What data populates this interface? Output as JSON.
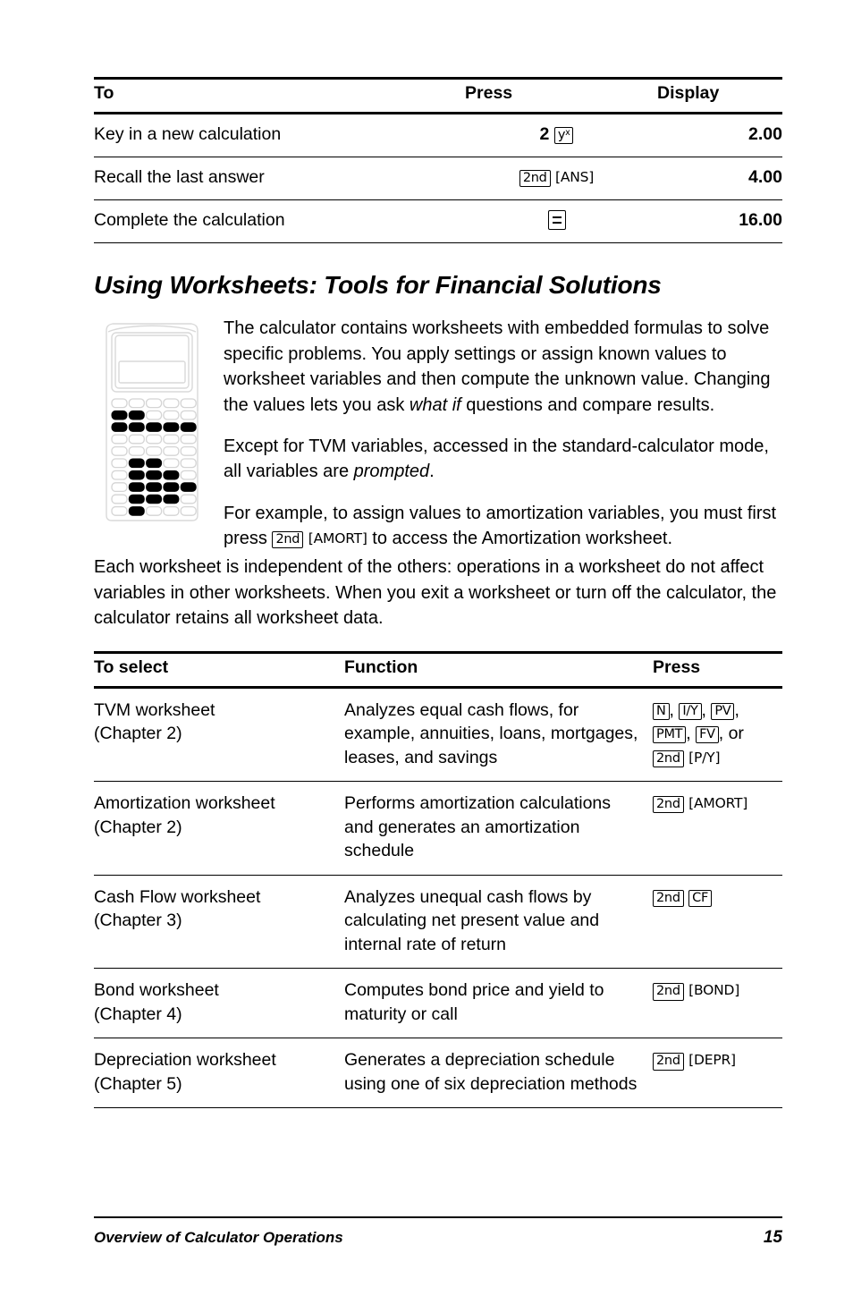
{
  "table_one": {
    "headers": [
      "To",
      "Press",
      "Display"
    ],
    "rows": [
      {
        "to": "Key in a new calculation",
        "press_prefix": "2",
        "press_key": "y",
        "press_sup": "x",
        "display": "2.00"
      },
      {
        "to": "Recall the last answer",
        "press_key": "2nd",
        "press_bracket": "[ANS]",
        "display": "4.00"
      },
      {
        "to": "Complete the calculation",
        "press_key": "=",
        "display": "16.00"
      }
    ]
  },
  "section": {
    "title": "Using Worksheets: Tools for Financial Solutions"
  },
  "intro": {
    "para1_a": "The calculator contains worksheets with embedded formulas to solve specific problems. You apply settings or assign known values to worksheet variables and then compute the unknown value. Changing the values lets you ask ",
    "para1_em": "what if",
    "para1_b": " questions and compare results.",
    "para2_a": "Except for TVM variables, accessed in the standard-calculator mode, all variables are ",
    "para2_em": "prompted",
    "para2_b": ".",
    "para3_a": "For example, to assign values to amortization variables, you must first press ",
    "para3_key": "2nd",
    "para3_bracket": "[AMORT]",
    "para3_b": " to access the Amortization worksheet."
  },
  "wide_paragraph": "Each worksheet is independent of the others: operations in a worksheet do not affect variables in other worksheets. When you exit a worksheet or turn off the calculator, the calculator retains all worksheet data.",
  "table_two": {
    "headers": [
      "To select",
      "Function",
      "Press"
    ],
    "rows": [
      {
        "select_line1": "TVM worksheet",
        "select_line2": "(Chapter 2)",
        "function": "Analyzes equal cash flows, for example, annuities, loans, mortgages, leases, and savings",
        "press_keys": [
          "N",
          "I/Y",
          "PV",
          "PMT",
          "FV"
        ],
        "press_or": "or",
        "press_second": "2nd",
        "press_bracket": "[P/Y]"
      },
      {
        "select_line1": "Amortization worksheet",
        "select_line2": "(Chapter 2)",
        "function": "Performs amortization calculations and generates an amortization schedule",
        "press_second": "2nd",
        "press_bracket": "[AMORT]"
      },
      {
        "select_line1": "Cash Flow worksheet",
        "select_line2": "(Chapter 3)",
        "function": "Analyzes unequal cash flows by calculating net present value and internal rate of return",
        "press_second": "2nd",
        "press_boxed": "CF"
      },
      {
        "select_line1": "Bond worksheet",
        "select_line2": "(Chapter 4)",
        "function": "Computes bond price and yield to maturity or call",
        "press_second": "2nd",
        "press_bracket": "[BOND]"
      },
      {
        "select_line1": "Depreciation worksheet",
        "select_line2": "(Chapter 5)",
        "function": "Generates a depreciation schedule using one of six depreciation methods",
        "press_second": "2nd",
        "press_bracket": "[DEPR]"
      }
    ]
  },
  "footer": {
    "chapter": "Overview of Calculator Operations",
    "page_number": "15"
  },
  "colors": {
    "text": "#000000",
    "rule": "#000000",
    "illustration_outline": "#d4d4d4",
    "illustration_key_fill": "#000000"
  },
  "illustration": {
    "name": "financial-calculator",
    "keypad_rows": [
      [
        "light",
        "light",
        "light",
        "light",
        "light"
      ],
      [
        "dark",
        "dark",
        "light",
        "light",
        "light"
      ],
      [
        "dark",
        "dark",
        "dark",
        "dark",
        "dark"
      ],
      [
        "light",
        "light",
        "light",
        "light",
        "light"
      ],
      [
        "light",
        "light",
        "light",
        "light",
        "light"
      ],
      [
        "light",
        "dark",
        "dark",
        "light",
        "light"
      ],
      [
        "light",
        "dark",
        "dark",
        "dark",
        "light"
      ],
      [
        "light",
        "dark",
        "dark",
        "dark",
        "dark"
      ],
      [
        "light",
        "dark",
        "dark",
        "dark",
        "light"
      ],
      [
        "light",
        "dark",
        "light",
        "light",
        "light"
      ]
    ]
  }
}
